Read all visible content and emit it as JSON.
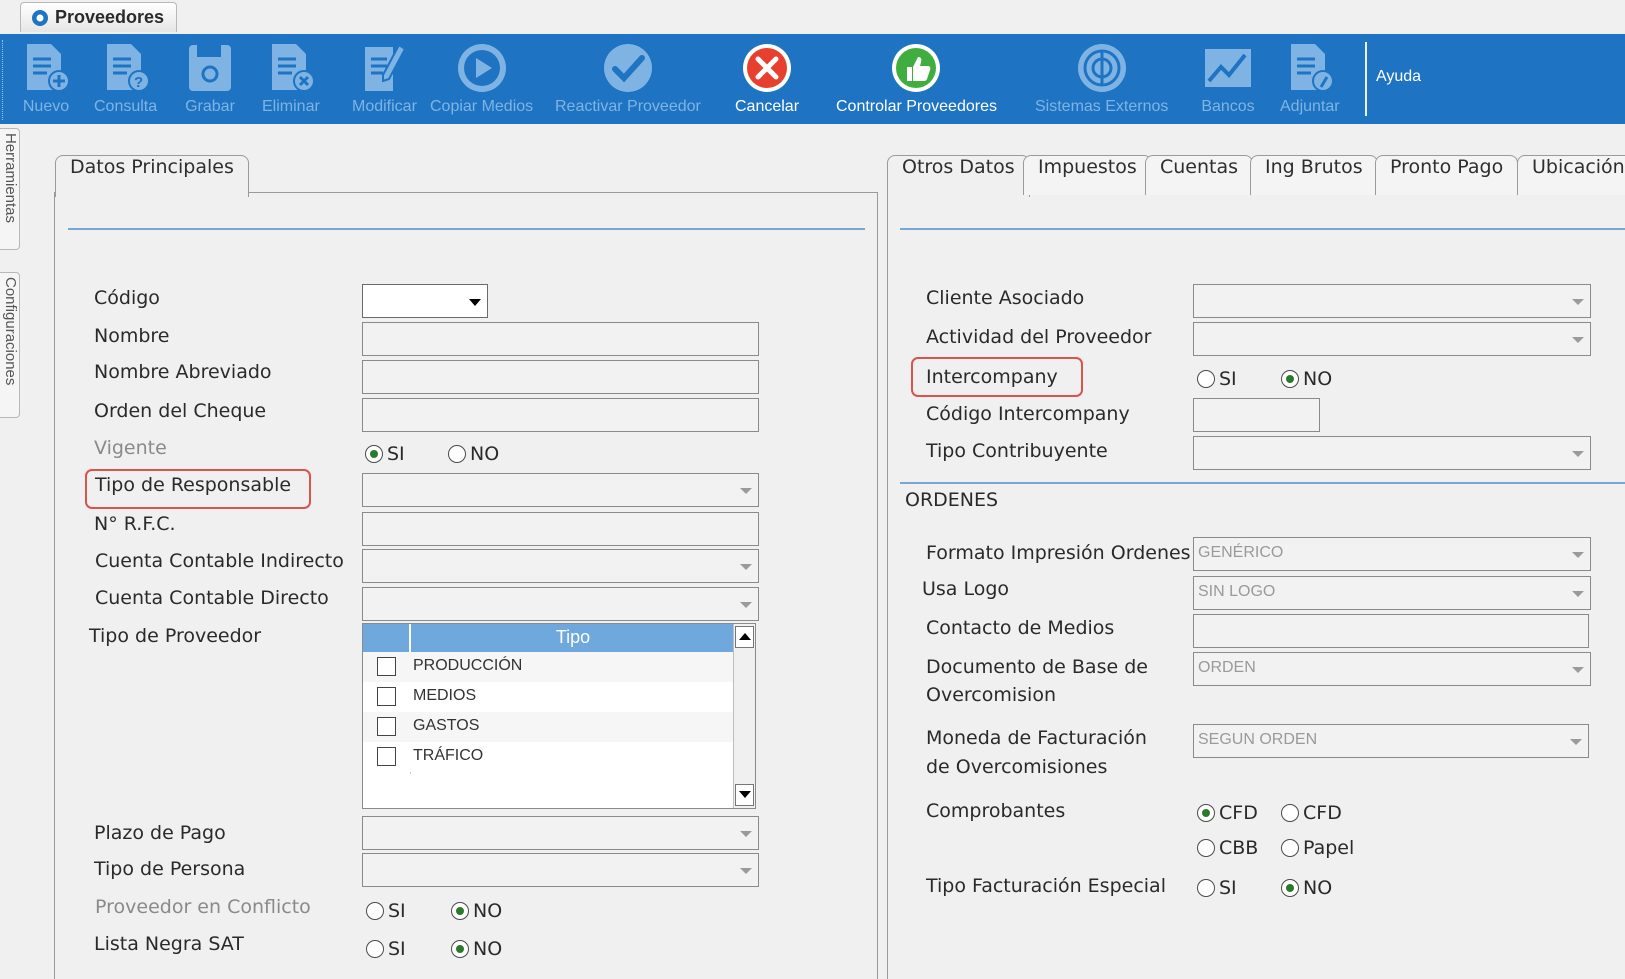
{
  "window_tab": "Proveedores",
  "toolbar": {
    "buttons": [
      {
        "label": "Nuevo",
        "icon": "new-document-icon"
      },
      {
        "label": "Consulta",
        "icon": "query-document-icon"
      },
      {
        "label": "Grabar",
        "icon": "save-icon"
      },
      {
        "label": "Eliminar",
        "icon": "delete-document-icon"
      },
      {
        "label": "Modificar",
        "icon": "edit-document-icon"
      },
      {
        "label": "Copiar Medios",
        "icon": "play-icon"
      },
      {
        "label": "Reactivar Proveedor",
        "icon": "checkmark-icon"
      },
      {
        "label": "Cancelar",
        "icon": "cancel-icon"
      },
      {
        "label": "Controlar Proveedores",
        "icon": "thumbs-up-icon"
      },
      {
        "label": "Sistemas Externos",
        "icon": "external-systems-icon"
      },
      {
        "label": "Bancos",
        "icon": "chart-icon"
      },
      {
        "label": "Adjuntar",
        "icon": "attach-icon"
      }
    ],
    "help": "Ayuda"
  },
  "side_tabs": [
    "Herramientas",
    "Configuraciones"
  ],
  "left_panel": {
    "tab": "Datos Principales",
    "fields": {
      "codigo": "Código",
      "nombre": "Nombre",
      "nombre_abreviado": "Nombre Abreviado",
      "orden_cheque": "Orden del Cheque",
      "vigente": "Vigente",
      "tipo_responsable": "Tipo de Responsable",
      "rfc": "N° R.F.C.",
      "cuenta_indirecto": "Cuenta Contable Indirecto",
      "cuenta_directo": "Cuenta Contable Directo",
      "tipo_proveedor": "Tipo de Proveedor",
      "plazo_pago": "Plazo de Pago",
      "tipo_persona": "Tipo de Persona",
      "proveedor_conflicto": "Proveedor en Conflicto",
      "lista_negra": "Lista Negra SAT"
    },
    "radio_si": "SI",
    "radio_no": "NO",
    "grid": {
      "header": "Tipo",
      "rows": [
        "PRODUCCIÓN",
        "MEDIOS",
        "GASTOS",
        "TRÁFICO"
      ]
    }
  },
  "right_panel": {
    "tabs": [
      "Otros Datos",
      "Impuestos",
      "Cuentas",
      "Ing Brutos",
      "Pronto Pago",
      "Ubicación"
    ],
    "fields": {
      "cliente_asociado": "Cliente Asociado",
      "actividad": "Actividad del Proveedor",
      "intercompany": "Intercompany",
      "codigo_intercompany": "Código Intercompany",
      "tipo_contribuyente": "Tipo Contribuyente"
    },
    "section_ordenes": "ORDENES",
    "ordenes": {
      "formato": "Formato Impresión Ordenes",
      "formato_val": "GENÉRICO",
      "usa_logo": "Usa Logo",
      "usa_logo_val": "SIN LOGO",
      "contacto": "Contacto de Medios",
      "doc_base_1": "Documento de Base de",
      "doc_base_2": "Overcomision",
      "doc_base_val": "ORDEN",
      "moneda_1": "Moneda de Facturación",
      "moneda_2": "de Overcomisiones",
      "moneda_val": "SEGUN ORDEN",
      "comprobantes": "Comprobantes",
      "comp_opts": [
        "CFD",
        "CFD",
        "CBB",
        "Papel"
      ],
      "tipo_fact": "Tipo Facturación Especial"
    },
    "radio_si": "SI",
    "radio_no": "NO"
  },
  "colors": {
    "toolbar": "#1e74c2",
    "highlight": "#d9534f",
    "grid_header": "#6fa8dc"
  }
}
